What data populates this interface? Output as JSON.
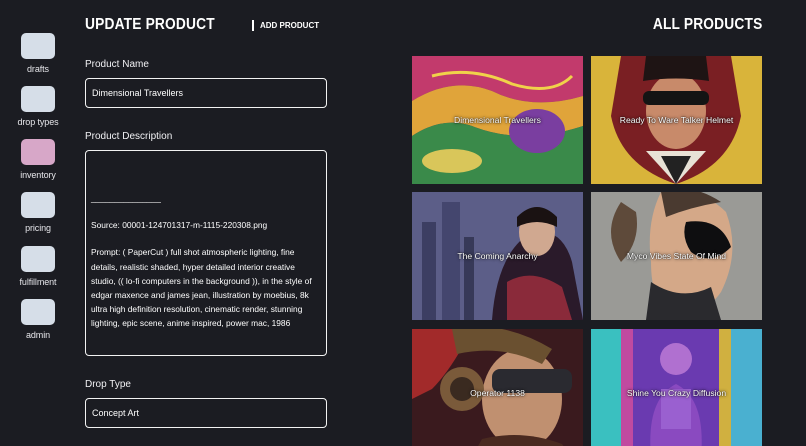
{
  "sidebar": {
    "items": [
      {
        "label": "drafts",
        "active": false
      },
      {
        "label": "drop types",
        "active": false
      },
      {
        "label": "inventory",
        "active": true
      },
      {
        "label": "pricing",
        "active": false
      },
      {
        "label": "fulfillment",
        "active": false
      },
      {
        "label": "admin",
        "active": false
      }
    ]
  },
  "header": {
    "title": "UPDATE PRODUCT",
    "add_product_label": "ADD PRODUCT",
    "all_products_title": "ALL PRODUCTS"
  },
  "form": {
    "product_name_label": "Product Name",
    "product_name_value": "Dimensional Travellers",
    "description_label": "Product Description",
    "description_lines": {
      "divider": "_______________",
      "source": "Source: 00001-124701317-m-1115-220308.png",
      "prompt": "Prompt: ( PaperCut ) full shot atmospheric lighting, fine details, realistic shaded, hyper detailed interior creative studio, (( lo-fi computers in the background )), in the style of edgar maxence and james jean, illustration by moebius, 8k ultra high definition resolution, cinematic render, stunning lighting, epic scene, anime inspired, power mac, 1986"
    },
    "drop_type_label": "Drop Type",
    "drop_type_value": "Concept Art"
  },
  "products": [
    {
      "title": "Dimensional Travellers"
    },
    {
      "title": "Ready To Ware Talker Helmet"
    },
    {
      "title": "The Coming Anarchy"
    },
    {
      "title": "Myco Vibes State Of Mind"
    },
    {
      "title": "Operator 1138"
    },
    {
      "title": "Shine You Crazy Diffusion"
    }
  ],
  "colors": {
    "background": "#1b1c22",
    "nav_tile": "#d6dee8",
    "nav_tile_active": "#d7a7c8"
  }
}
